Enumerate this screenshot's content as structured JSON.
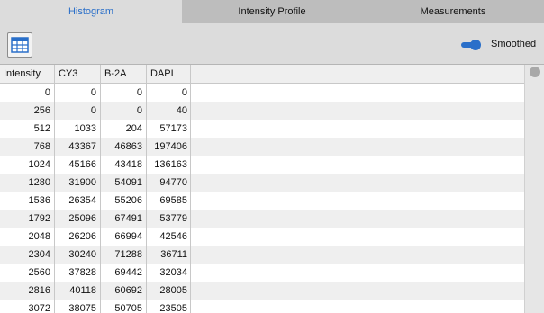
{
  "tabs": [
    {
      "label": "Histogram",
      "active": true
    },
    {
      "label": "Intensity Profile",
      "active": false
    },
    {
      "label": "Measurements",
      "active": false
    }
  ],
  "toolbar": {
    "grid_icon": "table-grid-icon",
    "smoothed_label": "Smoothed",
    "smoothed_on": true
  },
  "table": {
    "columns": [
      "Intensity",
      "CY3",
      "B-2A",
      "DAPI"
    ],
    "rows": [
      [
        "0",
        "0",
        "0",
        "0"
      ],
      [
        "256",
        "0",
        "0",
        "40"
      ],
      [
        "512",
        "1033",
        "204",
        "57173"
      ],
      [
        "768",
        "43367",
        "46863",
        "197406"
      ],
      [
        "1024",
        "45166",
        "43418",
        "136163"
      ],
      [
        "1280",
        "31900",
        "54091",
        "94770"
      ],
      [
        "1536",
        "26354",
        "55206",
        "69585"
      ],
      [
        "1792",
        "25096",
        "67491",
        "53779"
      ],
      [
        "2048",
        "26206",
        "66994",
        "42546"
      ],
      [
        "2304",
        "30240",
        "71288",
        "36711"
      ],
      [
        "2560",
        "37828",
        "69442",
        "32034"
      ],
      [
        "2816",
        "40118",
        "60692",
        "28005"
      ],
      [
        "3072",
        "38075",
        "50705",
        "23505"
      ]
    ]
  },
  "colors": {
    "accent": "#2a6fc9",
    "tab_inactive": "#bdbdbd",
    "row_alt": "#efefef"
  }
}
